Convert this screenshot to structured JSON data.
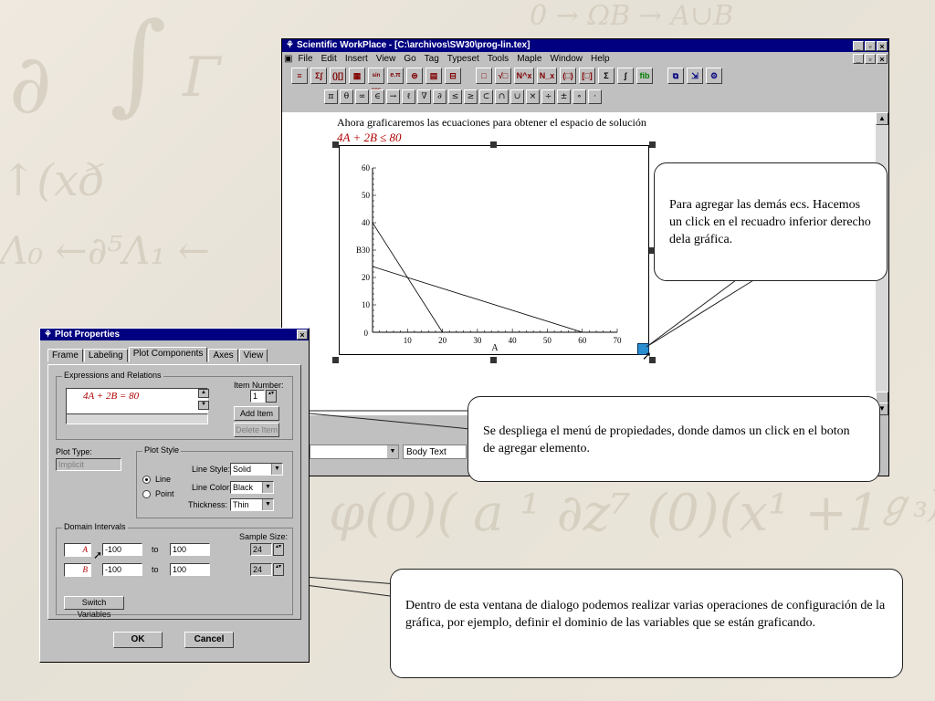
{
  "app": {
    "title": "Scientific WorkPlace - [C:\\archivos\\SW30\\prog-lin.tex]",
    "menu": [
      "File",
      "Edit",
      "Insert",
      "View",
      "Go",
      "Tag",
      "Typeset",
      "Tools",
      "Maple",
      "Window",
      "Help"
    ],
    "toolbar_buttons": [
      "≡",
      "Σ∫",
      "()[]",
      "▦",
      "sin cos",
      "e.π",
      "⊜",
      "▤",
      "⊟",
      "□",
      "√□",
      "N^x",
      "N_x",
      "(□)",
      "[□]",
      "Σ",
      "∫",
      "fib",
      "⧉",
      "⇲",
      "⚙"
    ],
    "symbol_buttons": [
      "π",
      "θ",
      "∞",
      "∈",
      "→",
      "ℓ",
      "∇",
      "∂",
      "≤",
      "≥",
      "⊂",
      "∩",
      "∪",
      "×",
      "÷",
      "±",
      "∘",
      "·"
    ],
    "status_combo1": "",
    "status_combo2": "Body Text"
  },
  "document": {
    "text": "Ahora graficaremos las ecuaciones para obtener el espacio de solución",
    "equation": "4A + 2B ≤ 80"
  },
  "chart_data": {
    "type": "line",
    "xlabel": "A",
    "ylabel": "B",
    "xlim": [
      0,
      70
    ],
    "ylim": [
      0,
      60
    ],
    "x_ticks": [
      10,
      20,
      30,
      40,
      50,
      60,
      70
    ],
    "y_ticks": [
      10,
      20,
      30,
      40,
      50,
      60
    ],
    "y_label_value": "30",
    "series": [
      {
        "x": [
          0,
          20
        ],
        "y": [
          40,
          0
        ]
      },
      {
        "x": [
          0,
          60
        ],
        "y": [
          24,
          0
        ]
      }
    ]
  },
  "callouts": [
    "Para agregar las demás ecs. Hacemos un click en el recuadro inferior derecho dela gráfica.",
    "Se despliega el menú de propiedades, donde damos un click en el boton de agregar elemento.",
    "Dentro de esta ventana de dialogo podemos realizar varias operaciones de configuración de la gráfica, por ejemplo, definir el dominio de las variables que se están graficando."
  ],
  "dialog": {
    "title": "Plot Properties",
    "close": "×",
    "tabs": [
      "Frame",
      "Labeling",
      "Plot Components",
      "Axes",
      "View"
    ],
    "expressions_label": "Expressions and Relations",
    "expression": "4A + 2B = 80",
    "item_number_label": "Item Number:",
    "item_number": "1",
    "add_item": "Add Item",
    "delete_item": "Delete Item",
    "plot_type_label": "Plot Type:",
    "plot_type": "Implicit",
    "plot_style_label": "Plot Style",
    "line_option": "Line",
    "point_option": "Point",
    "line_style_label": "Line Style:",
    "line_style": "Solid",
    "line_color_label": "Line Color:",
    "line_color": "Black",
    "thickness_label": "Thickness:",
    "thickness": "Thin",
    "domain_label": "Domain Intervals",
    "sample_size_label": "Sample Size:",
    "var1": "A",
    "var1_from": "-100",
    "var1_to": "100",
    "var1_samples": "24",
    "var2": "B",
    "var2_from": "-100",
    "var2_to": "100",
    "var2_samples": "24",
    "to_label": "to",
    "switch_variables": "Switch Variables",
    "ok": "OK",
    "cancel": "Cancel"
  },
  "window_buttons": [
    "_",
    "▫",
    "×"
  ],
  "colors": {
    "titlebar": "#000080",
    "math_red": "#b00000",
    "selection": "#2a8fd0"
  }
}
